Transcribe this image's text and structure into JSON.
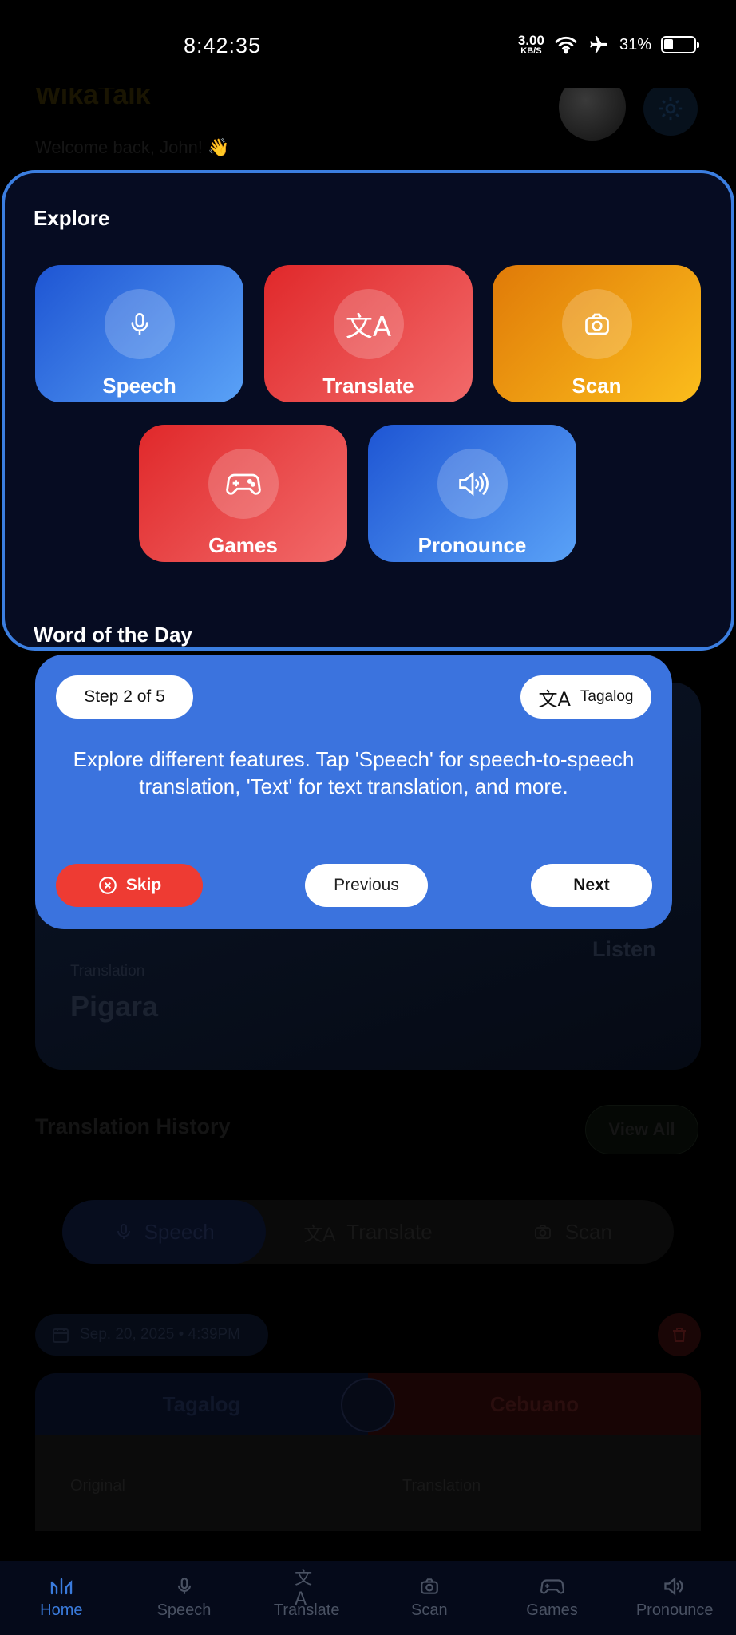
{
  "status_bar": {
    "time": "8:42:35",
    "net_speed": "3.00",
    "net_unit": "KB/S",
    "battery": "31%",
    "battery_level": 0.31
  },
  "app": {
    "title": "WikaTalk",
    "welcome": "Welcome back, John! 👋"
  },
  "explore": {
    "title": "Explore",
    "tiles": [
      {
        "label": "Speech",
        "icon": "mic-icon"
      },
      {
        "label": "Translate",
        "icon": "translate-icon"
      },
      {
        "label": "Scan",
        "icon": "camera-icon"
      },
      {
        "label": "Games",
        "icon": "gamepad-icon"
      },
      {
        "label": "Pronounce",
        "icon": "speaker-icon"
      }
    ]
  },
  "word_of_day": {
    "title": "Word of the Day",
    "translation_label": "Translation",
    "translation_value": "Pigara",
    "listen": "Listen"
  },
  "tour": {
    "step": "Step 2 of 5",
    "language": "Tagalog",
    "message": "Explore different features. Tap 'Speech' for speech-to-speech translation, 'Text' for text translation, and more.",
    "skip": "Skip",
    "previous": "Previous",
    "next": "Next"
  },
  "history": {
    "title": "Translation History",
    "view_all": "View All",
    "tabs": [
      "Speech",
      "Translate",
      "Scan"
    ],
    "date": "Sep. 20, 2025 • 4:39PM",
    "source_lang": "Tagalog",
    "target_lang": "Cebuano",
    "original_label": "Original",
    "translation_label": "Translation"
  },
  "nav": {
    "items": [
      "Home",
      "Speech",
      "Translate",
      "Scan",
      "Games",
      "Pronounce"
    ]
  },
  "colors": {
    "accent": "#3b7ee0",
    "tour_bg": "#3b73de",
    "skip": "#ee3b33",
    "nav_active": "#3a7bdc"
  }
}
